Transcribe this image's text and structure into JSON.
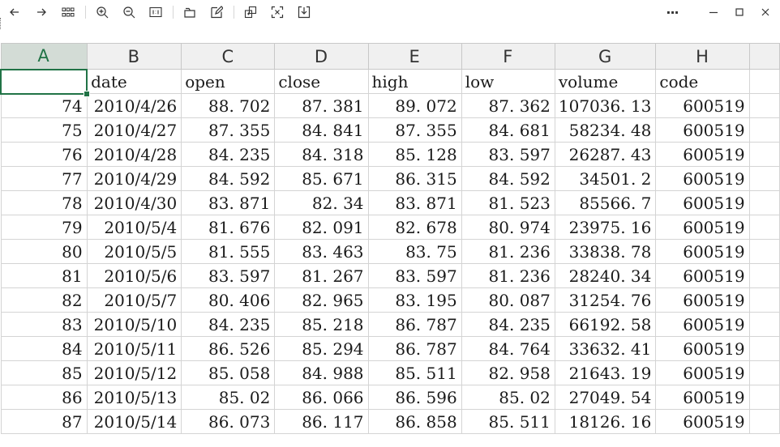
{
  "toolbar": {
    "buttons": [
      {
        "name": "back-button",
        "icon": "arrow-left-icon"
      },
      {
        "name": "forward-button",
        "icon": "arrow-right-icon"
      },
      {
        "name": "grid-view-button",
        "icon": "grid-icon"
      },
      {
        "name": "zoom-in-button",
        "icon": "zoom-in-icon"
      },
      {
        "name": "zoom-out-button",
        "icon": "zoom-out-icon"
      },
      {
        "name": "actual-size-button",
        "icon": "actual-size-icon"
      },
      {
        "name": "rotate-button",
        "icon": "rotate-icon"
      },
      {
        "name": "edit-button",
        "icon": "edit-icon"
      },
      {
        "name": "copy-button",
        "icon": "copy-icon"
      },
      {
        "name": "crop-button",
        "icon": "crop-icon"
      },
      {
        "name": "save-button",
        "icon": "download-icon"
      }
    ],
    "more_label": "···"
  },
  "window_controls": [
    "minimize-icon",
    "maximize-icon",
    "close-icon"
  ],
  "sheet": {
    "column_letters": [
      "A",
      "B",
      "C",
      "D",
      "E",
      "F",
      "G",
      "H"
    ],
    "active_column": "A",
    "header_row": [
      "",
      "date",
      "open",
      "close",
      "high",
      "low",
      "volume",
      "code"
    ],
    "rows": [
      [
        "74",
        "2010/4/26",
        "88. 702",
        "87. 381",
        "89. 072",
        "87. 362",
        "107036. 13",
        "600519"
      ],
      [
        "75",
        "2010/4/27",
        "87. 355",
        "84. 841",
        "87. 355",
        "84. 681",
        "58234. 48",
        "600519"
      ],
      [
        "76",
        "2010/4/28",
        "84. 235",
        "84. 318",
        "85. 128",
        "83. 597",
        "26287. 43",
        "600519"
      ],
      [
        "77",
        "2010/4/29",
        "84. 592",
        "85. 671",
        "86. 315",
        "84. 592",
        "34501. 2",
        "600519"
      ],
      [
        "78",
        "2010/4/30",
        "83. 871",
        "82. 34",
        "83. 871",
        "81. 523",
        "85566. 7",
        "600519"
      ],
      [
        "79",
        "2010/5/4",
        "81. 676",
        "82. 091",
        "82. 678",
        "80. 974",
        "23975. 16",
        "600519"
      ],
      [
        "80",
        "2010/5/5",
        "81. 555",
        "83. 463",
        "83. 75",
        "81. 236",
        "33838. 78",
        "600519"
      ],
      [
        "81",
        "2010/5/6",
        "83. 597",
        "81. 267",
        "83. 597",
        "81. 236",
        "28240. 34",
        "600519"
      ],
      [
        "82",
        "2010/5/7",
        "80. 406",
        "82. 965",
        "83. 195",
        "80. 087",
        "31254. 76",
        "600519"
      ],
      [
        "83",
        "2010/5/10",
        "84. 235",
        "85. 218",
        "86. 787",
        "84. 235",
        "66192. 58",
        "600519"
      ],
      [
        "84",
        "2010/5/11",
        "86. 526",
        "85. 294",
        "86. 787",
        "84. 764",
        "33632. 41",
        "600519"
      ],
      [
        "85",
        "2010/5/12",
        "85. 058",
        "84. 988",
        "85. 511",
        "82. 958",
        "21643. 19",
        "600519"
      ],
      [
        "86",
        "2010/5/13",
        "85. 02",
        "86. 066",
        "86. 596",
        "85. 02",
        "27049. 54",
        "600519"
      ],
      [
        "87",
        "2010/5/14",
        "86. 073",
        "86. 117",
        "86. 858",
        "85. 511",
        "18126. 16",
        "600519"
      ]
    ]
  },
  "colors": {
    "accent": "#217346",
    "header_bg": "#f0f0f0",
    "gridline": "#d4d4d4"
  }
}
